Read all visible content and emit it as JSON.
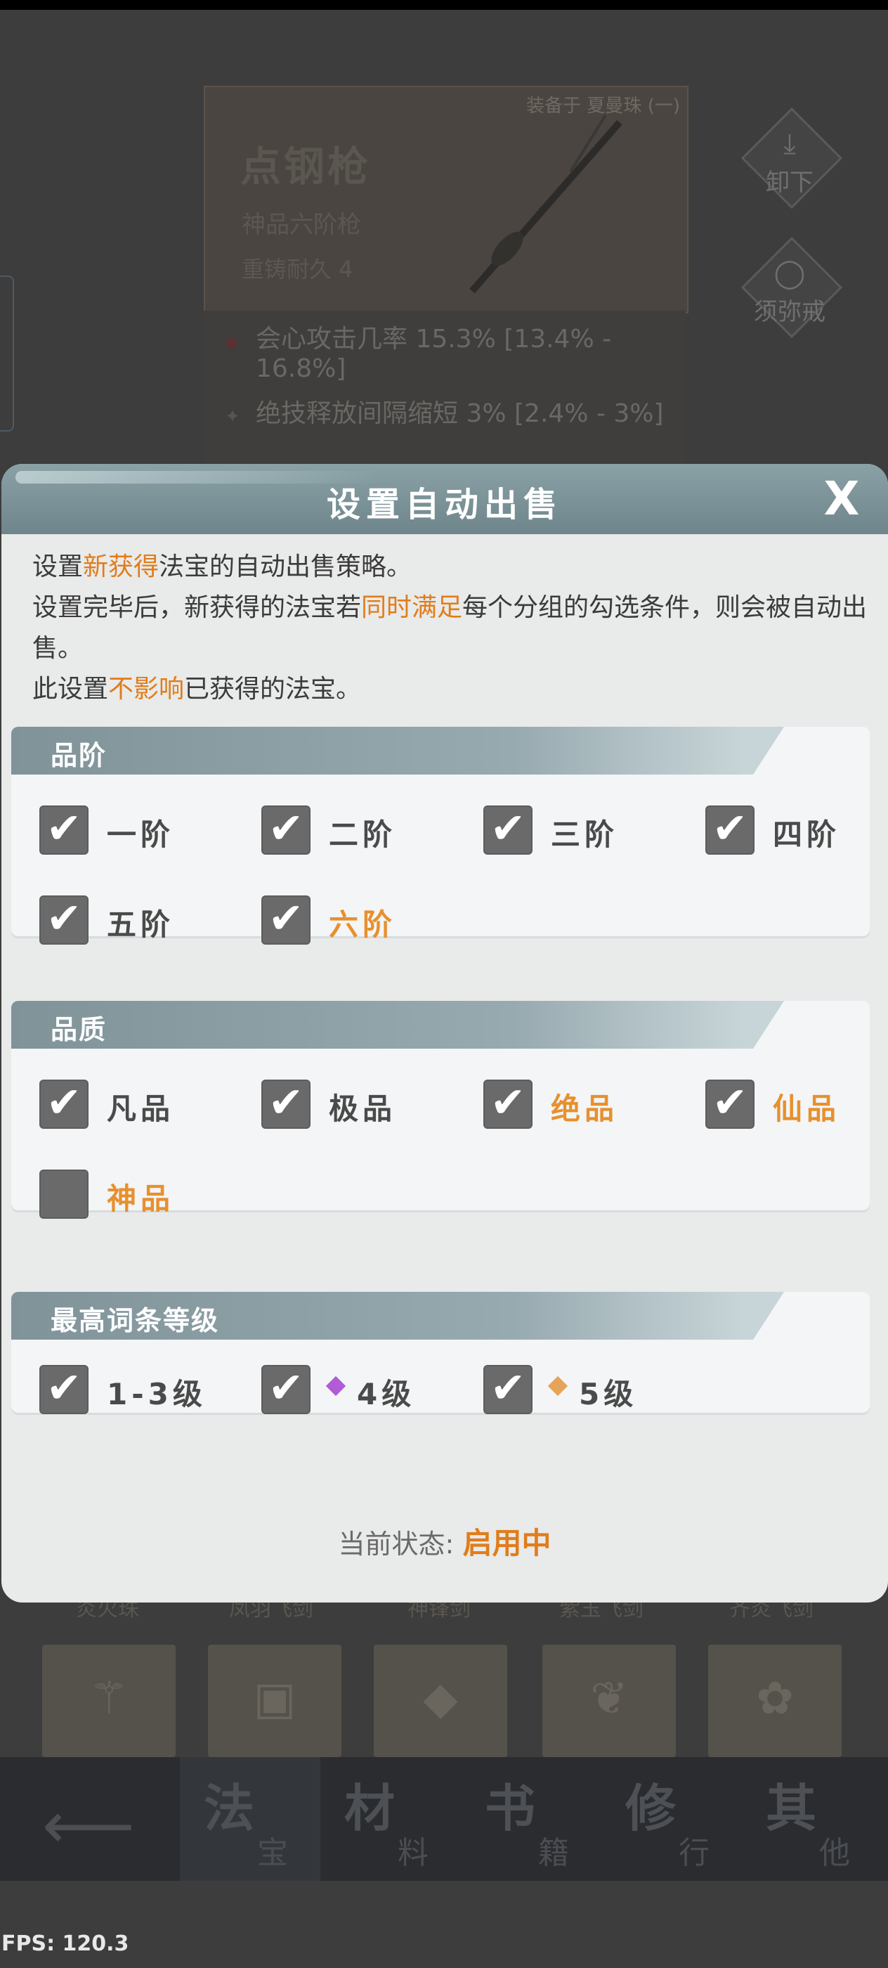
{
  "background": {
    "equipped_tag": "装备于 夏曼珠 (一)",
    "item_name": "点钢枪",
    "item_grade": "神品六阶枪",
    "item_durability": "重铸耐久 4",
    "stats": [
      "会心攻击几率 15.3% [13.4% - 16.8%]",
      "绝技释放间隔缩短 3% [2.4% - 3%]"
    ],
    "unequip_label": "卸下",
    "storage_label": "须弥戒",
    "item_labels": [
      "炎火珠",
      "凤羽飞剑",
      "神锋剑",
      "紫玉飞剑",
      "齐炎飞剑"
    ],
    "nav": {
      "tabs": [
        {
          "big": "法",
          "small": "宝"
        },
        {
          "big": "材",
          "small": "料"
        },
        {
          "big": "书",
          "small": "籍"
        },
        {
          "big": "修",
          "small": "行"
        },
        {
          "big": "其",
          "small": "他"
        }
      ]
    },
    "fps": "FPS: 120.3"
  },
  "dialog": {
    "title": "设置自动出售",
    "close_label": "X",
    "desc": {
      "l1_a": "设置",
      "l1_hl": "新获得",
      "l1_b": "法宝的自动出售策略。",
      "l2_a": "设置完毕后，新获得的法宝若",
      "l2_hl": "同时满足",
      "l2_b": "每个分组的勾选条件，则会被自动出售。",
      "l3_a": "此设置",
      "l3_hl": "不影响",
      "l3_b": "已获得的法宝。"
    },
    "groups": [
      {
        "title": "品阶",
        "options": [
          {
            "label": "一阶",
            "checked": true
          },
          {
            "label": "二阶",
            "checked": true
          },
          {
            "label": "三阶",
            "checked": true
          },
          {
            "label": "四阶",
            "checked": true
          },
          {
            "label": "五阶",
            "checked": true
          },
          {
            "label": "六阶",
            "checked": true,
            "color": "#e7902e"
          }
        ]
      },
      {
        "title": "品质",
        "options": [
          {
            "label": "凡品",
            "checked": true
          },
          {
            "label": "极品",
            "checked": true
          },
          {
            "label": "绝品",
            "checked": true,
            "color": "#e7902e"
          },
          {
            "label": "仙品",
            "checked": true,
            "color": "#e7902e"
          },
          {
            "label": "神品",
            "checked": false,
            "color": "#e7902e"
          }
        ]
      },
      {
        "title": "最高词条等级",
        "options": [
          {
            "label": "1-3级",
            "checked": true
          },
          {
            "label": "4级",
            "checked": true,
            "gem_color": "#b15bd6"
          },
          {
            "label": "5级",
            "checked": true,
            "gem_color": "#e5a45a"
          }
        ]
      }
    ],
    "status_label": "当前状态:",
    "status_value": "启用中"
  }
}
